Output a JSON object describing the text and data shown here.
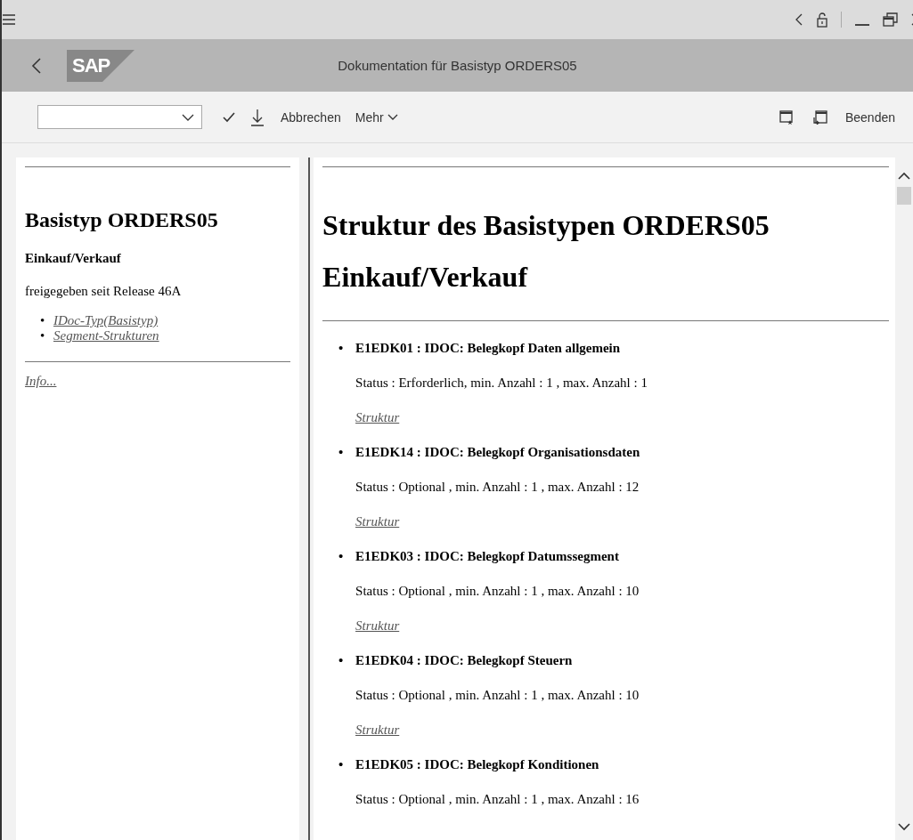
{
  "header": {
    "logo": "SAP",
    "title": "Dokumentation für Basistyp ORDERS05"
  },
  "toolbar": {
    "actions": [
      {
        "label": "Abbrechen",
        "kind": "text"
      },
      {
        "label": "Mehr",
        "kind": "menu"
      }
    ],
    "exit": "Beenden"
  },
  "sidebar": {
    "title": "Basistyp ORDERS05",
    "subtitle": "Einkauf/Verkauf",
    "release": "freigegeben seit Release 46A",
    "links": [
      {
        "bullet": "•",
        "label": "IDoc-Typ(Basistyp)"
      },
      {
        "bullet": "•",
        "label": "Segment-Strukturen"
      }
    ],
    "info": "Info..."
  },
  "main": {
    "heading": [
      "Struktur des Basistypen ORDERS05",
      "Einkauf/Verkauf"
    ],
    "segments": [
      {
        "bullet": "•",
        "title": "E1EDK01 : IDOC: Belegkopf Daten allgemein",
        "status": "Status : Erforderlich, min. Anzahl : 1 , max. Anzahl : 1",
        "link": "Struktur"
      },
      {
        "bullet": "•",
        "title": "E1EDK14 : IDOC: Belegkopf Organisationsdaten",
        "status": "Status : Optional , min. Anzahl : 1 , max. Anzahl : 12",
        "link": "Struktur"
      },
      {
        "bullet": "•",
        "title": "E1EDK03 : IDOC: Belegkopf Datumssegment",
        "status": "Status : Optional , min. Anzahl : 1 , max. Anzahl : 10",
        "link": "Struktur"
      },
      {
        "bullet": "•",
        "title": "E1EDK04 : IDOC: Belegkopf Steuern",
        "status": "Status : Optional , min. Anzahl : 1 , max. Anzahl : 10",
        "link": "Struktur"
      },
      {
        "bullet": "•",
        "title": "E1EDK05 : IDOC: Belegkopf Konditionen",
        "status": "Status : Optional , min. Anzahl : 1 , max. Anzahl : 16"
      }
    ]
  }
}
